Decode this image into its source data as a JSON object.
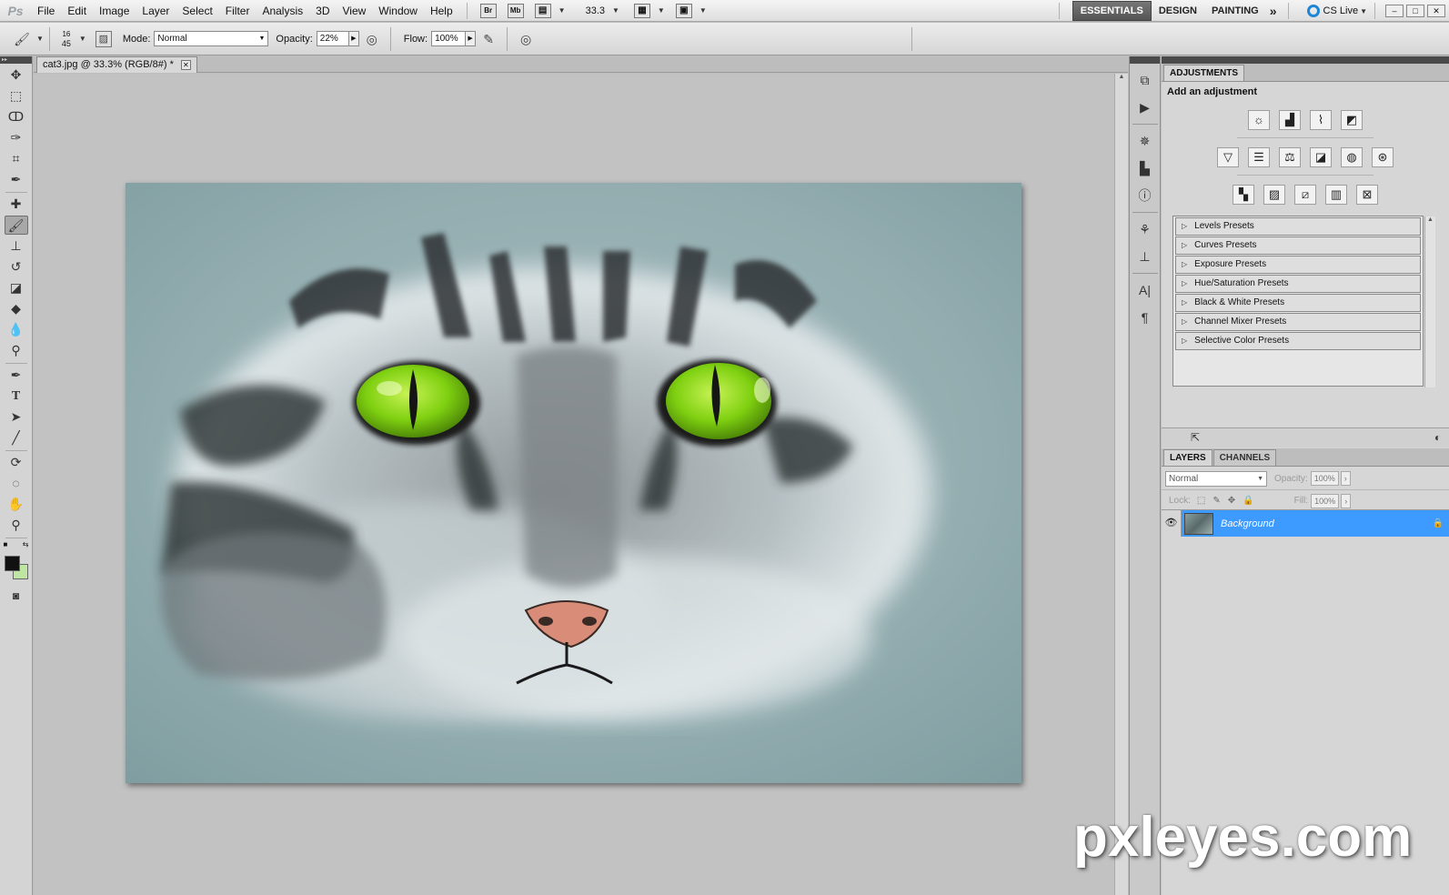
{
  "app": {
    "logo": "Ps"
  },
  "menu": [
    "File",
    "Edit",
    "Image",
    "Layer",
    "Select",
    "Filter",
    "Analysis",
    "3D",
    "View",
    "Window",
    "Help"
  ],
  "appbar": {
    "bridge": "Br",
    "minibridge": "Mb",
    "zoom": "33.3"
  },
  "workspaces": {
    "essentials": "ESSENTIALS",
    "design": "DESIGN",
    "painting": "PAINTING",
    "more": "»",
    "cslive": "CS Live"
  },
  "options": {
    "brush_size": "16",
    "brush_hardness": "45",
    "mode_label": "Mode:",
    "mode_value": "Normal",
    "opacity_label": "Opacity:",
    "opacity_value": "22%",
    "flow_label": "Flow:",
    "flow_value": "100%"
  },
  "document": {
    "tab_title": "cat3.jpg @ 33.3% (RGB/8#) *"
  },
  "colors": {
    "foreground": "#111111",
    "background": "#bfe5a3",
    "layer_selected": "#3d9aff",
    "eye": "#8fdc12"
  },
  "adjustments": {
    "tab": "ADJUSTMENTS",
    "title": "Add an adjustment",
    "presets": [
      "Levels Presets",
      "Curves Presets",
      "Exposure Presets",
      "Hue/Saturation Presets",
      "Black & White Presets",
      "Channel Mixer Presets",
      "Selective Color Presets"
    ]
  },
  "layers": {
    "tabs": [
      "LAYERS",
      "CHANNELS"
    ],
    "blend_mode": "Normal",
    "opacity_label": "Opacity:",
    "opacity_value": "100%",
    "lock_label": "Lock:",
    "fill_label": "Fill:",
    "fill_value": "100%",
    "items": [
      {
        "name": "Background",
        "visible": true,
        "locked": true
      }
    ]
  },
  "watermark": "pxleyes.com"
}
